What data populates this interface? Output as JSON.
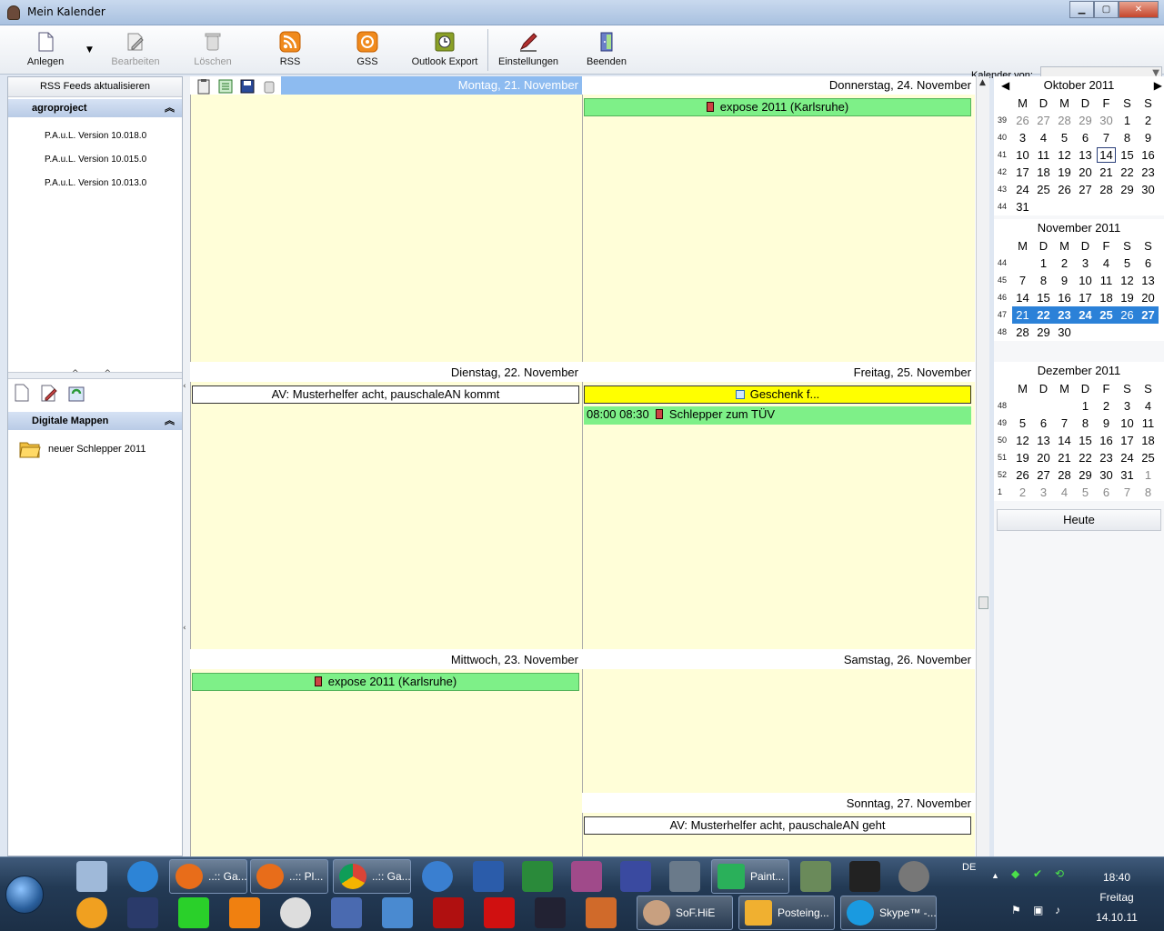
{
  "window": {
    "title": "Mein Kalender"
  },
  "toolbar": {
    "anlegen": "Anlegen",
    "bearbeiten": "Bearbeiten",
    "loeschen": "Löschen",
    "rss": "RSS",
    "gss": "GSS",
    "outlook": "Outlook Export",
    "einstellungen": "Einstellungen",
    "beenden": "Beenden",
    "kalender_von": "Kalender von:"
  },
  "left": {
    "rss_button": "RSS Feeds aktualisieren",
    "group1": {
      "title": "agroproject",
      "items": [
        "P.A.u.L. Version 10.018.0",
        "P.A.u.L. Version 10.015.0",
        "P.A.u.L. Version 10.013.0"
      ]
    },
    "group2": {
      "title": "Digitale Mappen",
      "items": [
        "neuer Schlepper 2011"
      ]
    }
  },
  "days": {
    "mon": {
      "label": "Montag, 21. November"
    },
    "tue": {
      "label": "Dienstag, 22. November",
      "events": [
        "AV: Musterhelfer acht, pauschaleAN kommt"
      ]
    },
    "wed": {
      "label": "Mittwoch, 23. November",
      "events": [
        "expose 2011 (Karlsruhe)"
      ]
    },
    "thu": {
      "label": "Donnerstag, 24. November",
      "events": [
        "expose 2011 (Karlsruhe)"
      ]
    },
    "fri": {
      "label": "Freitag, 25. November",
      "events": [
        "Geschenk f...",
        "08:00 08:30",
        "Schlepper zum TÜV"
      ]
    },
    "sat": {
      "label": "Samstag, 26. November"
    },
    "sun": {
      "label": "Sonntag, 27. November",
      "events": [
        "AV: Musterhelfer acht, pauschaleAN geht"
      ]
    }
  },
  "minical": {
    "weekdays": [
      "M",
      "D",
      "M",
      "D",
      "F",
      "S",
      "S"
    ],
    "oct": {
      "title": "Oktober 2011"
    },
    "nov": {
      "title": "November 2011"
    },
    "dec": {
      "title": "Dezember 2011"
    },
    "today_button": "Heute"
  },
  "taskbar": {
    "lang": "DE",
    "windows": [
      "..:: Ga...",
      "..:: Pl...",
      "..:: Ga...",
      "Paint...",
      "SoF.HiE",
      "Posteing...",
      "Skype™ -..."
    ],
    "time": "18:40",
    "weekday": "Freitag",
    "date": "14.10.11"
  }
}
